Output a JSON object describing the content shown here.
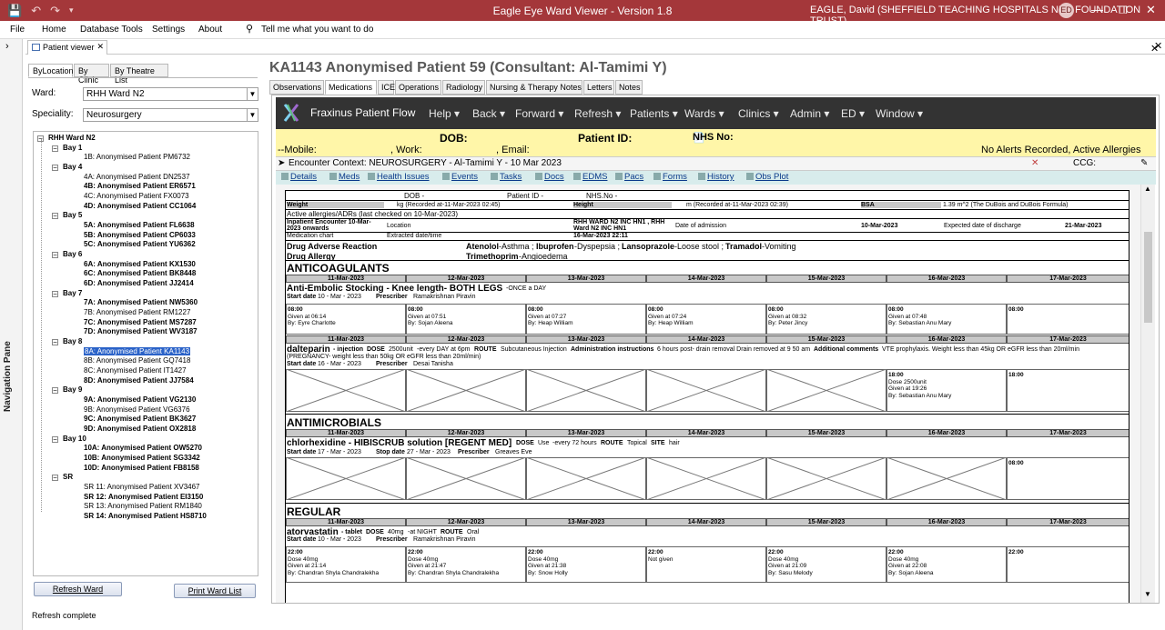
{
  "app": {
    "title": "Eagle Eye Ward Viewer - Version 1.8",
    "user": "EAGLE, David (SHEFFIELD TEACHING HOSPITALS NHS FOUNDATION TRUST)",
    "initials": "ED"
  },
  "menu": [
    "File",
    "Home",
    "Database Tools",
    "Settings",
    "About"
  ],
  "tell_me": "Tell me what you want to do",
  "nav_pane_label": "Navigation Pane",
  "doc_tab": "Patient viewer",
  "left": {
    "tabs": [
      "ByLocation",
      "By Clinic",
      "By Theatre List"
    ],
    "ward_label": "Ward:",
    "ward_value": "RHH Ward N2",
    "speciality_label": "Speciality:",
    "speciality_value": "Neurosurgery",
    "tree": [
      {
        "t": "RHH Ward N2",
        "lvl": 0,
        "b": true
      },
      {
        "t": "Bay 1",
        "lvl": 1,
        "b": true
      },
      {
        "t": "1B: Anonymised Patient PM6732",
        "lvl": 2,
        "b": false
      },
      {
        "t": "Bay 4",
        "lvl": 1,
        "b": true
      },
      {
        "t": "4A: Anonymised Patient DN2537",
        "lvl": 2,
        "b": false
      },
      {
        "t": "4B: Anonymised Patient ER6571",
        "lvl": 2,
        "b": true
      },
      {
        "t": "4C: Anonymised Patient FX0073",
        "lvl": 2,
        "b": false
      },
      {
        "t": "4D: Anonymised Patient CC1064",
        "lvl": 2,
        "b": true
      },
      {
        "t": "Bay 5",
        "lvl": 1,
        "b": true
      },
      {
        "t": "5A: Anonymised Patient FL6638",
        "lvl": 2,
        "b": true
      },
      {
        "t": "5B: Anonymised Patient CP6033",
        "lvl": 2,
        "b": true
      },
      {
        "t": "5C: Anonymised Patient YU6362",
        "lvl": 2,
        "b": true
      },
      {
        "t": "Bay 6",
        "lvl": 1,
        "b": true
      },
      {
        "t": "6A: Anonymised Patient KX1530",
        "lvl": 2,
        "b": true
      },
      {
        "t": "6C: Anonymised Patient BK8448",
        "lvl": 2,
        "b": true
      },
      {
        "t": "6D: Anonymised Patient JJ2414",
        "lvl": 2,
        "b": true
      },
      {
        "t": "Bay 7",
        "lvl": 1,
        "b": true
      },
      {
        "t": "7A: Anonymised Patient NW5360",
        "lvl": 2,
        "b": true
      },
      {
        "t": "7B: Anonymised Patient RM1227",
        "lvl": 2,
        "b": false
      },
      {
        "t": "7C: Anonymised Patient MS7287",
        "lvl": 2,
        "b": true
      },
      {
        "t": "7D: Anonymised Patient WV3187",
        "lvl": 2,
        "b": true
      },
      {
        "t": "Bay 8",
        "lvl": 1,
        "b": true
      },
      {
        "t": "8A: Anonymised Patient KA1143",
        "lvl": 2,
        "b": false,
        "selected": true
      },
      {
        "t": "8B: Anonymised Patient GQ7418",
        "lvl": 2,
        "b": false
      },
      {
        "t": "8C: Anonymised Patient IT1427",
        "lvl": 2,
        "b": false
      },
      {
        "t": "8D: Anonymised Patient JJ7584",
        "lvl": 2,
        "b": true
      },
      {
        "t": "Bay 9",
        "lvl": 1,
        "b": true
      },
      {
        "t": "9A: Anonymised Patient VG2130",
        "lvl": 2,
        "b": true
      },
      {
        "t": "9B: Anonymised Patient VG6376",
        "lvl": 2,
        "b": false
      },
      {
        "t": "9C: Anonymised Patient BK3627",
        "lvl": 2,
        "b": true
      },
      {
        "t": "9D: Anonymised Patient OX2818",
        "lvl": 2,
        "b": true
      },
      {
        "t": "Bay 10",
        "lvl": 1,
        "b": true
      },
      {
        "t": "10A: Anonymised Patient OW5270",
        "lvl": 2,
        "b": true
      },
      {
        "t": "10B: Anonymised Patient SG3342",
        "lvl": 2,
        "b": true
      },
      {
        "t": "10D: Anonymised Patient FB8158",
        "lvl": 2,
        "b": true
      },
      {
        "t": "SR",
        "lvl": 1,
        "b": true
      },
      {
        "t": "SR 11: Anonymised Patient XV3467",
        "lvl": 2,
        "b": false
      },
      {
        "t": "SR 12: Anonymised Patient EI3150",
        "lvl": 2,
        "b": true
      },
      {
        "t": "SR 13: Anonymised Patient RM1840",
        "lvl": 2,
        "b": false
      },
      {
        "t": "SR 14: Anonymised Patient HS8710",
        "lvl": 2,
        "b": true
      }
    ],
    "refresh_ward": "Refresh Ward",
    "print_ward": "Print Ward List"
  },
  "status": "Refresh complete",
  "patient_title": "KA1143 Anonymised Patient 59 (Consultant: Al-Tamimi Y)",
  "tabs": [
    "Observations",
    "Medications",
    "ICE",
    "Operations",
    "Radiology",
    "Nursing & Therapy Notes",
    "Letters",
    "Notes"
  ],
  "fx": {
    "name": "Fraxinus Patient Flow",
    "menu": [
      "Help",
      "Back",
      "Forward",
      "Refresh",
      "Patients",
      "Wards",
      "Clinics",
      "Admin",
      "ED",
      "Window"
    ],
    "dob": "DOB:",
    "patient_id": "Patient ID:",
    "nhs_no": "NHS No:",
    "mobile": "--Mobile:",
    "work": ", Work:",
    "email": ", Email:",
    "alerts": "No Alerts Recorded, Active Allergies",
    "encounter": "Encounter Context: NEUROSURGERY - Al-Tamimi Y - 10 Mar 2023",
    "ccg": "CCG:",
    "tools": [
      "Details",
      "Meds",
      "Health Issues",
      "Events",
      "Tasks",
      "Docs",
      "EDMS",
      "Pacs",
      "Forms",
      "History",
      "Obs Plot"
    ]
  },
  "chart": {
    "hdr_dob": "DOB -",
    "hdr_pid": "Patient ID -",
    "hdr_nhs": "NHS.No -",
    "weight_lbl": "Weight",
    "weight_val": "kg (Recorded at-11-Mar-2023 02:45)",
    "height_lbl": "Height",
    "height_val": "m (Recorded at-11-Mar-2023 02:39)",
    "bsa_lbl": "BSA",
    "bsa_val": "1.39 m^2 (The DuBois and DuBois Formula)",
    "allergy_check": "Active allergies/ADRs (last checked on 10-Mar-2023)",
    "enc_lbl": "Inpatient Encounter 10-Mar-2023 onwards",
    "location_lbl": "Location",
    "location_val": "RHH WARD N2 INC HN1 , RHH Ward N2 INC HN1",
    "doa_lbl": "Date of admission",
    "doa_val": "10-Mar-2023",
    "edd_lbl": "Expected date of discharge",
    "edd_val": "21-Mar-2023",
    "medchart_lbl": "Medication chart",
    "extracted_lbl": "Extracted date/time",
    "extracted_val": "16-Mar-2023 22:11",
    "adr_lbl": "Drug Adverse Reaction",
    "adr_val_parts": [
      [
        "Atenolol",
        "-Asthma ; "
      ],
      [
        "Ibuprofen",
        "-Dyspepsia ; "
      ],
      [
        "Lansoprazole",
        "-Loose stool ; "
      ],
      [
        "Tramadol",
        "-Vomiting"
      ]
    ],
    "allergy_lbl": "Drug Allergy",
    "allergy_val_parts": [
      [
        "Trimethoprim",
        "-Angioedema"
      ]
    ],
    "dates": [
      "11-Mar-2023",
      "12-Mar-2023",
      "13-Mar-2023",
      "14-Mar-2023",
      "15-Mar-2023",
      "16-Mar-2023",
      "17-Mar-2023"
    ],
    "sec_anticoag": "ANTICOAGULANTS",
    "sec_antimicro": "ANTIMICROBIALS",
    "sec_regular": "REGULAR",
    "med1": {
      "name": "Anti-Embolic Stocking - Knee length- BOTH LEGS",
      "freq": "-ONCE a DAY",
      "start_lbl": "Start date",
      "start": "10 - Mar - 2023",
      "presc_lbl": "Prescriber",
      "presc": "Ramakrishnan Piravin",
      "slots": [
        [
          "08:00",
          "Given at 06:14",
          "By: Eyre Charlotte"
        ],
        [
          "08:00",
          "Given at 07:51",
          "By: Sojan Aleena"
        ],
        [
          "08:00",
          "Given at 07:27",
          "By: Heap William"
        ],
        [
          "08:00",
          "Given at 07:24",
          "By: Heap William"
        ],
        [
          "08:00",
          "Given at 08:32",
          "By: Peter Jincy"
        ],
        [
          "08:00",
          "Given at 07:48",
          "By: Sebastian Anu Mary"
        ],
        [
          "08:00",
          "",
          ""
        ]
      ]
    },
    "med2": {
      "name": "dalteparin",
      "form": "- injection",
      "dose_lbl": "DOSE",
      "dose": "2500unit",
      "freq": "-every DAY at 6pm",
      "route_lbl": "ROUTE",
      "route": "Subcutaneous Injection",
      "admin_lbl": "Administration instructions",
      "admin": "6 hours post- drain removal Drain removed at 9 50 am",
      "add_lbl": "Additional comments",
      "add": "VTE prophylaxis. Weight less than 45kg OR eGFR less than 20ml/min",
      "add2": "(PREGNANCY- weight less than 50kg OR eGFR less than 20ml/min)",
      "start_lbl": "Start date",
      "start": "16 - Mar - 2023",
      "presc_lbl": "Prescriber",
      "presc": "Desai Tanisha",
      "slot6": [
        "18:00",
        "Dose 2500unit",
        "Given at 19:26",
        "By: Sebastian Anu Mary"
      ],
      "slot7": [
        "18:00"
      ]
    },
    "med3": {
      "name": "chlorhexidine - HIBISCRUB solution [REGENT MED]",
      "dose_lbl": "DOSE",
      "dose": "Use",
      "freq": "-every 72 hours",
      "route_lbl": "ROUTE",
      "route": "Topical",
      "site_lbl": "SITE",
      "site": "hair",
      "start_lbl": "Start date",
      "start": "17 - Mar - 2023",
      "stop_lbl": "Stop date",
      "stop": "27 - Mar - 2023",
      "presc_lbl": "Prescriber",
      "presc": "Greaves Eve",
      "slot7": [
        "08:00"
      ]
    },
    "med4": {
      "name": "atorvastatin",
      "form": "- tablet",
      "dose_lbl": "DOSE",
      "dose": "40mg",
      "freq": "-at NIGHT",
      "route_lbl": "ROUTE",
      "route": "Oral",
      "start_lbl": "Start date",
      "start": "10 - Mar - 2023",
      "presc_lbl": "Prescriber",
      "presc": "Ramakrishnan Piravin",
      "slots": [
        [
          "22:00",
          "Dose 40mg",
          "Given at 21:14",
          "By: Chandran Shyla Chandralekha"
        ],
        [
          "22:00",
          "Dose 40mg",
          "Given at 21:47",
          "By: Chandran Shyla Chandralekha"
        ],
        [
          "22:00",
          "Dose 40mg",
          "Given at 21:38",
          "By: Snow Holly"
        ],
        [
          "22:00",
          "Not given",
          "",
          ""
        ],
        [
          "22:00",
          "Dose 40mg",
          "Given at 21:09",
          "By: Sasu Melody"
        ],
        [
          "22:00",
          "Dose 40mg",
          "Given at 22:08",
          "By: Sojan Aleena"
        ],
        [
          "22:00",
          "",
          "",
          ""
        ]
      ]
    }
  }
}
